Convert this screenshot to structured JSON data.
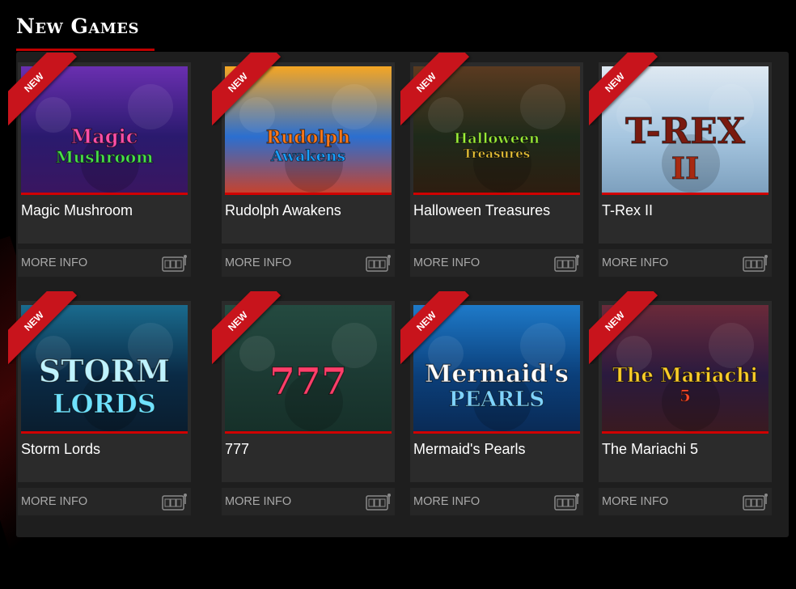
{
  "section": {
    "title": "New Games"
  },
  "ribbon_label": "NEW",
  "more_info_label": "MORE INFO",
  "colors": {
    "accent": "#c8141c",
    "panel": "#1e1e1e",
    "card": "#2b2b2b"
  },
  "games": [
    {
      "name": "Magic Mushroom",
      "thumb_text": "Magic Mushroom",
      "new": true
    },
    {
      "name": "Rudolph Awakens",
      "thumb_text": "Rudolph Awakens",
      "new": true
    },
    {
      "name": "Halloween Treasures",
      "thumb_text": "Halloween Treasures",
      "new": true
    },
    {
      "name": "T-Rex II",
      "thumb_text": "T-REX II",
      "new": true
    },
    {
      "name": "Storm Lords",
      "thumb_text": "STORM LORDS",
      "new": true
    },
    {
      "name": "777",
      "thumb_text": "777",
      "new": true
    },
    {
      "name": "Mermaid's Pearls",
      "thumb_text": "Mermaid's PEARLS",
      "new": true
    },
    {
      "name": "The Mariachi 5",
      "thumb_text": "The Mariachi 5",
      "new": true
    }
  ]
}
